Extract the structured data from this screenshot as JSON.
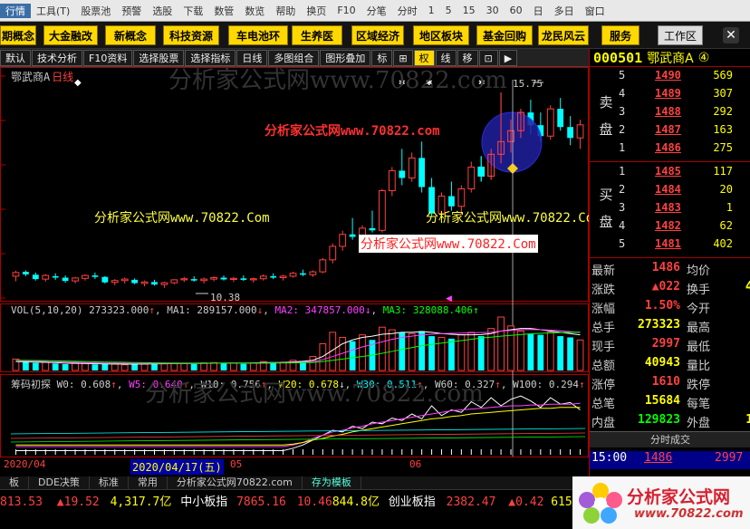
{
  "menu": [
    "行情",
    "工具(T)",
    "股票池",
    "预警",
    "选股",
    "下载",
    "数管",
    "数览",
    "帮助",
    "换页",
    "F10",
    "分笔",
    "分时",
    "1",
    "5",
    "15",
    "30",
    "60",
    "日",
    "多日",
    "窗口"
  ],
  "menu_selected_index": 0,
  "blocks": [
    "期概念",
    "大金融改",
    "新概念",
    "科技资源",
    "车电池环",
    "生养医",
    "区域经济",
    "地区板块",
    "基金回购",
    "龙民风云",
    "服务"
  ],
  "workspace_label": "工作区",
  "close_symbol": "✕",
  "toolbar": [
    "默认",
    "技术分析",
    "F10资料",
    "选择股票",
    "选择指标",
    "日线",
    "多图组合",
    "图形叠加",
    "标",
    "⊞",
    "权",
    "线",
    "移",
    "⊡",
    "▶"
  ],
  "toolbar_active": "权",
  "chart": {
    "stock_label": "鄂武商A",
    "period_label": "日线",
    "watermark": "分析家公式网www.70822.com",
    "promo_yellow_1": "分析家公式网www.70822.Com",
    "promo_yellow_2": "分析家公式网www.70822.Com",
    "promo_red_top": "分析家公式网www.70822.com",
    "promo_white_box": "分析家公式网www.70822.Com",
    "high_marker": "15.75",
    "low_marker": "10.38",
    "vol_indicator": {
      "name": "VOL(5,10,20)",
      "value": "273323.000",
      "ma1": "289157.000",
      "ma2": "347857.000",
      "ma3": "328088.406"
    },
    "chip_indicator": {
      "name": "筹码初探",
      "w0": "0.608",
      "w5": "0.640",
      "w10": "0.756",
      "w20": "0.678",
      "w30": "0.511",
      "w60": "0.327",
      "w100": "0.294"
    },
    "watermark2": "分析家公式网www.70822.com",
    "date_labels": [
      "2020/04",
      "2020/04/17(五)",
      "05",
      "06"
    ]
  },
  "chart_data": {
    "type": "candlestick",
    "security": "000501 鄂武商A",
    "candles": [
      [
        10.7,
        10.85,
        10.56,
        10.8
      ],
      [
        10.82,
        10.86,
        10.7,
        10.75
      ],
      [
        10.74,
        10.8,
        10.58,
        10.62
      ],
      [
        10.62,
        10.76,
        10.55,
        10.72
      ],
      [
        10.7,
        10.78,
        10.6,
        10.66
      ],
      [
        10.66,
        10.72,
        10.52,
        10.57
      ],
      [
        10.57,
        10.68,
        10.5,
        10.65
      ],
      [
        10.64,
        10.75,
        10.58,
        10.72
      ],
      [
        10.72,
        10.8,
        10.62,
        10.68
      ],
      [
        10.68,
        10.7,
        10.5,
        10.53
      ],
      [
        10.53,
        10.62,
        10.45,
        10.58
      ],
      [
        10.58,
        10.66,
        10.5,
        10.62
      ],
      [
        10.6,
        10.64,
        10.48,
        10.51
      ],
      [
        10.5,
        10.58,
        10.42,
        10.54
      ],
      [
        10.54,
        10.6,
        10.44,
        10.47
      ],
      [
        10.47,
        10.55,
        10.38,
        10.52
      ],
      [
        10.52,
        10.62,
        10.48,
        10.6
      ],
      [
        10.6,
        10.68,
        10.54,
        10.63
      ],
      [
        10.62,
        10.7,
        10.55,
        10.58
      ],
      [
        10.58,
        10.66,
        10.5,
        10.62
      ],
      [
        10.62,
        10.7,
        10.56,
        10.66
      ],
      [
        10.66,
        10.72,
        10.58,
        10.61
      ],
      [
        10.61,
        10.68,
        10.54,
        10.64
      ],
      [
        10.64,
        10.72,
        10.57,
        10.6
      ],
      [
        10.6,
        10.66,
        10.52,
        10.63
      ],
      [
        10.63,
        10.75,
        10.58,
        10.7
      ],
      [
        10.7,
        10.78,
        10.62,
        10.66
      ],
      [
        10.66,
        10.74,
        10.58,
        10.7
      ],
      [
        10.7,
        10.82,
        10.66,
        10.78
      ],
      [
        10.78,
        10.88,
        10.7,
        10.74
      ],
      [
        10.74,
        10.86,
        10.68,
        10.82
      ],
      [
        10.82,
        11.2,
        10.78,
        11.15
      ],
      [
        11.15,
        11.6,
        11.05,
        11.52
      ],
      [
        11.52,
        11.95,
        11.4,
        11.85
      ],
      [
        11.85,
        12.3,
        11.7,
        11.78
      ],
      [
        11.78,
        12.1,
        11.6,
        12.02
      ],
      [
        12.02,
        12.5,
        11.9,
        11.96
      ],
      [
        11.96,
        13.1,
        11.9,
        13.05
      ],
      [
        13.05,
        13.7,
        12.9,
        13.6
      ],
      [
        13.6,
        14.2,
        13.2,
        13.4
      ],
      [
        13.4,
        14.1,
        13.3,
        13.95
      ],
      [
        13.95,
        14.4,
        13.0,
        13.15
      ],
      [
        13.15,
        13.4,
        12.35,
        12.42
      ],
      [
        12.42,
        13.0,
        12.3,
        12.9
      ],
      [
        12.9,
        13.3,
        12.5,
        12.62
      ],
      [
        12.62,
        13.2,
        12.4,
        13.1
      ],
      [
        13.1,
        13.85,
        13.0,
        13.7
      ],
      [
        13.7,
        14.0,
        13.3,
        13.45
      ],
      [
        13.45,
        14.2,
        13.35,
        14.05
      ],
      [
        14.05,
        15.75,
        13.8,
        14.4
      ],
      [
        14.4,
        15.0,
        14.1,
        14.7
      ],
      [
        14.7,
        15.3,
        14.5,
        15.2
      ],
      [
        15.2,
        15.55,
        14.6,
        14.85
      ],
      [
        14.85,
        15.2,
        14.4,
        14.55
      ],
      [
        14.55,
        15.4,
        14.45,
        15.3
      ],
      [
        15.3,
        15.6,
        14.7,
        14.8
      ],
      [
        14.8,
        15.1,
        14.3,
        14.5
      ],
      [
        14.5,
        15.0,
        14.2,
        14.86
      ]
    ],
    "ylim": [
      10.1,
      16.2
    ],
    "volumes": [
      90,
      70,
      60,
      65,
      55,
      50,
      60,
      55,
      48,
      52,
      50,
      45,
      55,
      50,
      60,
      52,
      58,
      55,
      50,
      60,
      62,
      55,
      58,
      52,
      60,
      70,
      60,
      65,
      80,
      75,
      110,
      210,
      300,
      260,
      230,
      280,
      240,
      340,
      320,
      300,
      290,
      310,
      270,
      260,
      250,
      280,
      300,
      270,
      330,
      420,
      350,
      310,
      290,
      280,
      300,
      270,
      260,
      240
    ],
    "volume_ma": [
      {
        "name": "MA1",
        "values": [
          70,
          68,
          66,
          64,
          62,
          58,
          56,
          55,
          53,
          52,
          51,
          50,
          50,
          51,
          52,
          53,
          54,
          55,
          55,
          56,
          57,
          58,
          58,
          58,
          59,
          62,
          62,
          63,
          68,
          72,
          80,
          110,
          160,
          210,
          240,
          260,
          270,
          285,
          290,
          300,
          300,
          305,
          300,
          290,
          285,
          280,
          280,
          282,
          290,
          310,
          320,
          330,
          330,
          320,
          310,
          300,
          290,
          280
        ]
      },
      {
        "name": "MA2",
        "values": [
          75,
          74,
          72,
          70,
          68,
          66,
          64,
          62,
          60,
          58,
          57,
          56,
          55,
          55,
          55,
          55,
          55,
          55,
          56,
          56,
          57,
          57,
          58,
          58,
          58,
          59,
          60,
          61,
          63,
          65,
          70,
          85,
          110,
          135,
          160,
          185,
          205,
          225,
          245,
          260,
          270,
          280,
          285,
          290,
          292,
          294,
          296,
          298,
          300,
          310,
          315,
          320,
          322,
          320,
          318,
          312,
          305,
          298
        ]
      },
      {
        "name": "MA3",
        "values": [
          80,
          79,
          78,
          77,
          76,
          74,
          72,
          70,
          68,
          66,
          65,
          64,
          62,
          61,
          60,
          59,
          58,
          58,
          58,
          58,
          58,
          58,
          58,
          58,
          58,
          58,
          59,
          59,
          60,
          61,
          63,
          70,
          80,
          90,
          100,
          110,
          120,
          135,
          150,
          165,
          180,
          195,
          205,
          215,
          225,
          235,
          245,
          255,
          262,
          270,
          276,
          282,
          288,
          292,
          295,
          298,
          300,
          302
        ]
      }
    ],
    "chip_lines": [
      {
        "name": "W0",
        "color": "#ffffff",
        "values": [
          5,
          5,
          5,
          5,
          5,
          5,
          5,
          5,
          5,
          5,
          5,
          5,
          5,
          5,
          5,
          5,
          5,
          5,
          5,
          5,
          5,
          5,
          5,
          5,
          5,
          5,
          5,
          5,
          8,
          12,
          18,
          24,
          30,
          28,
          35,
          32,
          40,
          38,
          45,
          42,
          50,
          44,
          60,
          48,
          55,
          52,
          65,
          58,
          70,
          60,
          68,
          72,
          66,
          58,
          70,
          62,
          64,
          55
        ]
      },
      {
        "name": "W5",
        "color": "#ff40ff",
        "values": [
          10,
          10,
          10,
          10,
          10,
          10,
          10,
          10,
          10,
          10,
          10,
          10,
          10,
          10,
          10,
          10,
          10,
          10,
          10,
          10,
          10,
          10,
          10,
          10,
          10,
          10,
          10,
          10,
          12,
          15,
          20,
          24,
          28,
          30,
          33,
          35,
          38,
          40,
          42,
          44,
          46,
          48,
          50,
          52,
          54,
          55,
          56,
          57,
          58,
          59,
          60,
          60,
          61,
          61,
          62,
          62,
          62,
          63
        ]
      },
      {
        "name": "W10",
        "color": "#ffff00",
        "values": [
          12,
          12,
          12,
          12,
          12,
          12,
          12,
          12,
          12,
          12,
          12,
          12,
          12,
          12,
          12,
          12,
          12,
          12,
          12,
          12,
          12,
          12,
          12,
          12,
          12,
          12,
          12,
          12,
          13,
          15,
          18,
          20,
          23,
          25,
          28,
          30,
          32,
          34,
          36,
          38,
          40,
          42,
          44,
          45,
          47,
          48,
          50,
          51,
          52,
          53,
          54,
          55,
          56,
          57,
          57,
          58,
          58,
          58
        ]
      }
    ]
  },
  "quote": {
    "code": "000501",
    "name": "鄂武商A",
    "suffix": "④",
    "sell_label": "卖盘",
    "buy_label": "买盘",
    "sell": [
      {
        "lv": "5",
        "p": "1490",
        "v": "569"
      },
      {
        "lv": "4",
        "p": "1489",
        "v": "307"
      },
      {
        "lv": "3",
        "p": "1488",
        "v": "292"
      },
      {
        "lv": "2",
        "p": "1487",
        "v": "163"
      },
      {
        "lv": "1",
        "p": "1486",
        "v": "275"
      }
    ],
    "buy": [
      {
        "lv": "1",
        "p": "1485",
        "v": "117"
      },
      {
        "lv": "2",
        "p": "1484",
        "v": "20"
      },
      {
        "lv": "3",
        "p": "1483",
        "v": "1"
      },
      {
        "lv": "4",
        "p": "1482",
        "v": "62"
      },
      {
        "lv": "5",
        "p": "1481",
        "v": "402"
      }
    ],
    "stats": [
      {
        "k": "最新",
        "v": "1486",
        "vc": "#ff4040",
        "k2": "均价",
        "v2": ""
      },
      {
        "k": "涨跌",
        "v": "▲022",
        "vc": "#ff4040",
        "k2": "换手",
        "v2": "4"
      },
      {
        "k": "涨幅",
        "v": "1.50%",
        "vc": "#ff4040",
        "k2": "今开",
        "v2": ""
      },
      {
        "k": "总手",
        "v": "273323",
        "vc": "#ffff00",
        "k2": "最高",
        "v2": ""
      },
      {
        "k": "现手",
        "v": "2997",
        "vc": "#ff4040",
        "k2": "最低",
        "v2": ""
      },
      {
        "k": "总额",
        "v": "40943",
        "vc": "#ffff00",
        "k2": "量比",
        "v2": ""
      },
      {
        "k": "涨停",
        "v": "1610",
        "vc": "#ff4040",
        "k2": "跌停",
        "v2": ""
      },
      {
        "k": "总笔",
        "v": "15684",
        "vc": "#ffff00",
        "k2": "每笔",
        "v2": ""
      },
      {
        "k": "内盘",
        "v": "129823",
        "vc": "#00ff00",
        "k2": "外盘",
        "v2": "14"
      }
    ],
    "trade_header": "分时成交",
    "trade": {
      "time": "15:00",
      "price": "1486",
      "vol": "2997"
    }
  },
  "tabs": [
    "板",
    "DDE决策",
    "标准",
    "常用",
    "分析家公式网70822.com",
    "存为模板"
  ],
  "status": {
    "s1": "813.53",
    "s2": "▲19.52",
    "s3": "4,317.7亿",
    "s4": "中小板指",
    "s5": "7865.16",
    "s6": "10.46",
    "s7": "844.8亿",
    "s8": "创业板指",
    "s9": "2382.47",
    "s10": "▲0.42",
    "s11": "615.5"
  },
  "logo": {
    "text": "分析家公式网",
    "url": "www.70822.com"
  },
  "colors": {
    "up": "#ff4040",
    "down": "#00ffff",
    "yellow": "#ffff00",
    "panel_border": "#aa0000"
  }
}
